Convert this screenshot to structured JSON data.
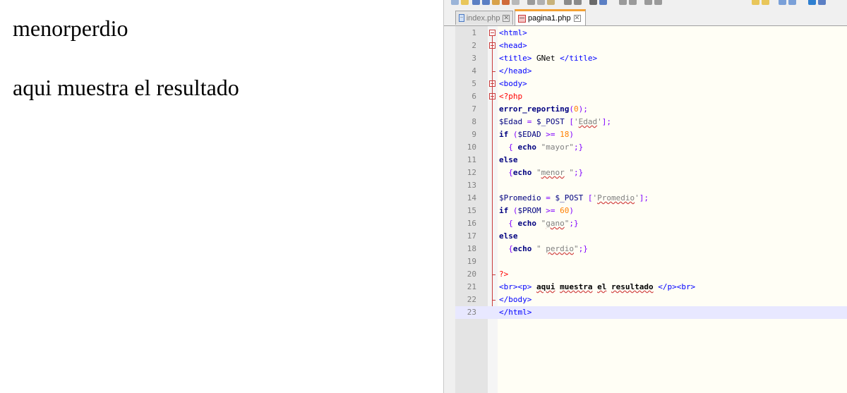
{
  "browser": {
    "output_line1": "menorperdio",
    "output_line2": "aqui muestra el resultado"
  },
  "editor": {
    "tabs": [
      {
        "label": "index.php",
        "active": false,
        "icon": "php-file-icon"
      },
      {
        "label": "pagina1.php",
        "active": true,
        "icon": "php-file-modified-icon"
      }
    ],
    "tab_close_glyph": "✕",
    "line_numbers": [
      "1",
      "2",
      "3",
      "4",
      "5",
      "6",
      "7",
      "8",
      "9",
      "10",
      "11",
      "12",
      "13",
      "14",
      "15",
      "16",
      "17",
      "18",
      "19",
      "20",
      "21",
      "22",
      "23"
    ],
    "current_line": 23,
    "code_lines": [
      [
        {
          "t": "<html>",
          "c": "tag"
        }
      ],
      [
        {
          "t": "<head>",
          "c": "tag"
        }
      ],
      [
        {
          "t": "<title>",
          "c": "tag"
        },
        {
          "t": " GNet ",
          "c": "plain"
        },
        {
          "t": "</title>",
          "c": "tag"
        }
      ],
      [
        {
          "t": "</head>",
          "c": "tag"
        }
      ],
      [
        {
          "t": "<body>",
          "c": "tag"
        }
      ],
      [
        {
          "t": "<?php",
          "c": "php"
        }
      ],
      [
        {
          "t": "error_reporting",
          "c": "fn"
        },
        {
          "t": "(",
          "c": "op"
        },
        {
          "t": "0",
          "c": "num"
        },
        {
          "t": ");",
          "c": "op"
        }
      ],
      [
        {
          "t": "$Edad",
          "c": "var"
        },
        {
          "t": " = ",
          "c": "op"
        },
        {
          "t": "$_POST",
          "c": "var"
        },
        {
          "t": " [",
          "c": "op"
        },
        {
          "t": "'",
          "c": "str"
        },
        {
          "t": "Edad",
          "c": "str",
          "sq": true
        },
        {
          "t": "'",
          "c": "str"
        },
        {
          "t": "];",
          "c": "op"
        }
      ],
      [
        {
          "t": "if",
          "c": "kw"
        },
        {
          "t": " (",
          "c": "op"
        },
        {
          "t": "$EDAD",
          "c": "var"
        },
        {
          "t": " >= ",
          "c": "op"
        },
        {
          "t": "18",
          "c": "num"
        },
        {
          "t": ")",
          "c": "op"
        }
      ],
      [
        {
          "t": "  { ",
          "c": "op"
        },
        {
          "t": "echo",
          "c": "kw"
        },
        {
          "t": " \"mayor\"",
          "c": "str"
        },
        {
          "t": ";}",
          "c": "op"
        }
      ],
      [
        {
          "t": "else",
          "c": "kw"
        }
      ],
      [
        {
          "t": "  {",
          "c": "op"
        },
        {
          "t": "echo",
          "c": "kw"
        },
        {
          "t": " \"",
          "c": "str"
        },
        {
          "t": "menor",
          "c": "str",
          "sq": true
        },
        {
          "t": " \"",
          "c": "str"
        },
        {
          "t": ";}",
          "c": "op"
        }
      ],
      [
        {
          "t": "",
          "c": "plain"
        }
      ],
      [
        {
          "t": "$Promedio",
          "c": "var"
        },
        {
          "t": " = ",
          "c": "op"
        },
        {
          "t": "$_POST",
          "c": "var"
        },
        {
          "t": " [",
          "c": "op"
        },
        {
          "t": "'",
          "c": "str"
        },
        {
          "t": "Promedio",
          "c": "str",
          "sq": true
        },
        {
          "t": "'",
          "c": "str"
        },
        {
          "t": "];",
          "c": "op"
        }
      ],
      [
        {
          "t": "if",
          "c": "kw"
        },
        {
          "t": " (",
          "c": "op"
        },
        {
          "t": "$PROM",
          "c": "var"
        },
        {
          "t": " >= ",
          "c": "op"
        },
        {
          "t": "60",
          "c": "num"
        },
        {
          "t": ")",
          "c": "op"
        }
      ],
      [
        {
          "t": "  { ",
          "c": "op"
        },
        {
          "t": "echo",
          "c": "kw"
        },
        {
          "t": " \"",
          "c": "str"
        },
        {
          "t": "gano",
          "c": "str",
          "sq": true
        },
        {
          "t": "\"",
          "c": "str"
        },
        {
          "t": ";}",
          "c": "op"
        }
      ],
      [
        {
          "t": "else",
          "c": "kw"
        }
      ],
      [
        {
          "t": "  {",
          "c": "op"
        },
        {
          "t": "echo",
          "c": "kw"
        },
        {
          "t": " \" ",
          "c": "str"
        },
        {
          "t": "perdio",
          "c": "str",
          "sq": true
        },
        {
          "t": "\"",
          "c": "str"
        },
        {
          "t": ";}",
          "c": "op"
        }
      ],
      [
        {
          "t": "",
          "c": "plain"
        }
      ],
      [
        {
          "t": "?>",
          "c": "php"
        }
      ],
      [
        {
          "t": "<br><p>",
          "c": "tag"
        },
        {
          "t": " ",
          "c": "plain"
        },
        {
          "t": "aqui",
          "c": "bold",
          "sq": true
        },
        {
          "t": " ",
          "c": "plain"
        },
        {
          "t": "muestra",
          "c": "bold",
          "sq": true
        },
        {
          "t": " ",
          "c": "plain"
        },
        {
          "t": "el",
          "c": "bold",
          "sq": true
        },
        {
          "t": " ",
          "c": "plain"
        },
        {
          "t": "resultado",
          "c": "bold",
          "sq": true
        },
        {
          "t": " ",
          "c": "plain"
        },
        {
          "t": "</p><br>",
          "c": "tag"
        }
      ],
      [
        {
          "t": "</body>",
          "c": "tag"
        }
      ],
      [
        {
          "t": "</html>",
          "c": "tag"
        }
      ]
    ]
  },
  "colors": {
    "tab_accent": "#f3a134",
    "tag": "#0000ff",
    "php": "#ff0000",
    "keyword": "#000080",
    "number": "#ff8000",
    "string": "#808080",
    "current_line": "#e8e8ff"
  }
}
